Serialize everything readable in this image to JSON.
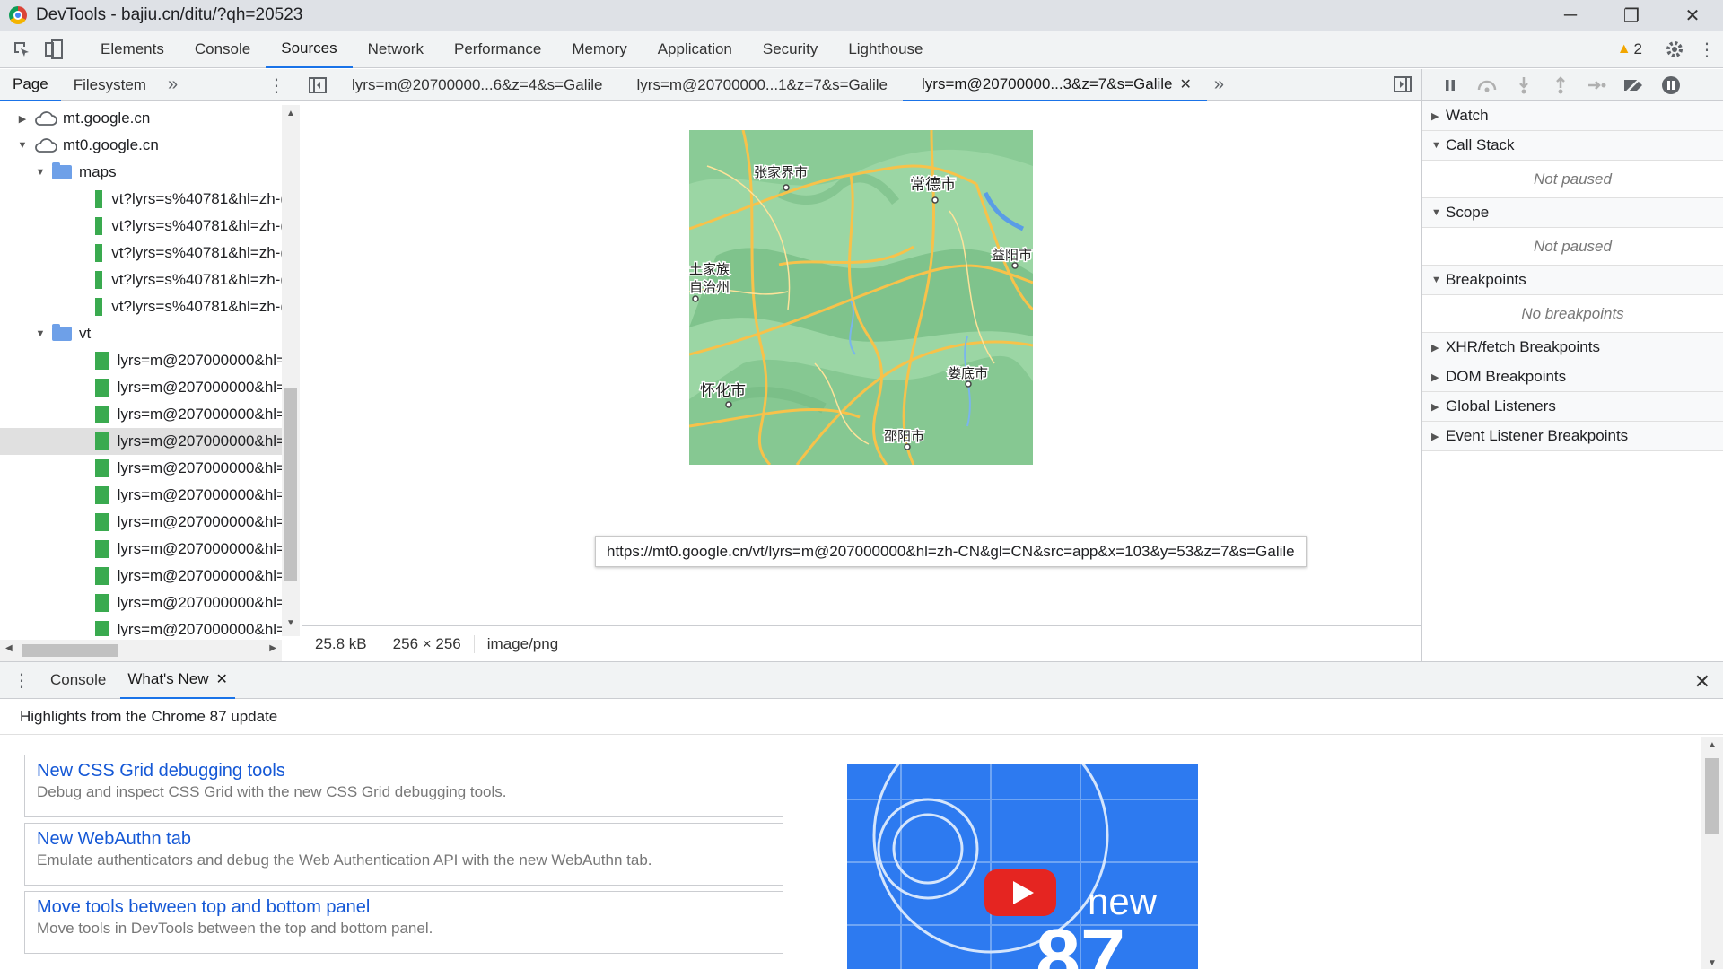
{
  "window": {
    "title": "DevTools - bajiu.cn/ditu/?qh=20523",
    "min": "─",
    "restore": "❐",
    "close": "✕"
  },
  "toolbar": {
    "tabs": [
      "Elements",
      "Console",
      "Sources",
      "Network",
      "Performance",
      "Memory",
      "Application",
      "Security",
      "Lighthouse"
    ],
    "active_tab": "Sources",
    "warning_count": "2"
  },
  "navigator": {
    "tabs": [
      "Page",
      "Filesystem"
    ],
    "more": "»",
    "tree": [
      {
        "label": "mt.google.cn",
        "type": "domain",
        "expanded": false,
        "indent": 0
      },
      {
        "label": "mt0.google.cn",
        "type": "domain",
        "expanded": true,
        "indent": 0
      },
      {
        "label": "maps",
        "type": "folder",
        "expanded": true,
        "indent": 1
      },
      {
        "label": "vt?lyrs=s%40781&hl=zh-(",
        "type": "file",
        "indent": 2
      },
      {
        "label": "vt?lyrs=s%40781&hl=zh-(",
        "type": "file",
        "indent": 2
      },
      {
        "label": "vt?lyrs=s%40781&hl=zh-(",
        "type": "file",
        "indent": 2
      },
      {
        "label": "vt?lyrs=s%40781&hl=zh-(",
        "type": "file",
        "indent": 2
      },
      {
        "label": "vt?lyrs=s%40781&hl=zh-(",
        "type": "file",
        "indent": 2
      },
      {
        "label": "vt",
        "type": "folder",
        "expanded": true,
        "indent": 1
      },
      {
        "label": "lyrs=m@207000000&hl=",
        "type": "file",
        "indent": 2
      },
      {
        "label": "lyrs=m@207000000&hl=",
        "type": "file",
        "indent": 2
      },
      {
        "label": "lyrs=m@207000000&hl=",
        "type": "file",
        "indent": 2
      },
      {
        "label": "lyrs=m@207000000&hl=",
        "type": "file",
        "indent": 2,
        "selected": true
      },
      {
        "label": "lyrs=m@207000000&hl=",
        "type": "file",
        "indent": 2
      },
      {
        "label": "lyrs=m@207000000&hl=",
        "type": "file",
        "indent": 2
      },
      {
        "label": "lyrs=m@207000000&hl=",
        "type": "file",
        "indent": 2
      },
      {
        "label": "lyrs=m@207000000&hl=",
        "type": "file",
        "indent": 2
      },
      {
        "label": "lyrs=m@207000000&hl=",
        "type": "file",
        "indent": 2
      },
      {
        "label": "lyrs=m@207000000&hl=",
        "type": "file",
        "indent": 2
      },
      {
        "label": "lyrs=m@207000000&hl=",
        "type": "file",
        "indent": 2
      }
    ]
  },
  "editor": {
    "tabs": [
      {
        "label": "lyrs=m@20700000...6&z=4&s=Galile",
        "active": false
      },
      {
        "label": "lyrs=m@20700000...1&z=7&s=Galile",
        "active": false
      },
      {
        "label": "lyrs=m@20700000...3&z=7&s=Galile",
        "active": true
      }
    ],
    "tooltip": "https://mt0.google.cn/vt/lyrs=m@207000000&hl=zh-CN&gl=CN&src=app&x=103&y=53&z=7&s=Galile",
    "map_labels": [
      "张家界市",
      "常德市",
      "益阳市",
      "土家族",
      "自治州",
      "怀化市",
      "娄底市",
      "邵阳市"
    ],
    "status": {
      "size": "25.8 kB",
      "dimensions": "256 × 256",
      "mime": "image/png"
    }
  },
  "debugger": {
    "sections": [
      {
        "title": "Watch",
        "expanded": false
      },
      {
        "title": "Call Stack",
        "expanded": true,
        "body": "Not paused"
      },
      {
        "title": "Scope",
        "expanded": true,
        "body": "Not paused"
      },
      {
        "title": "Breakpoints",
        "expanded": true,
        "body": "No breakpoints"
      },
      {
        "title": "XHR/fetch Breakpoints",
        "expanded": false
      },
      {
        "title": "DOM Breakpoints",
        "expanded": false
      },
      {
        "title": "Global Listeners",
        "expanded": false
      },
      {
        "title": "Event Listener Breakpoints",
        "expanded": false
      }
    ]
  },
  "drawer": {
    "tabs": [
      "Console",
      "What's New"
    ],
    "active_tab": "What's New",
    "header": "Highlights from the Chrome 87 update",
    "cards": [
      {
        "title": "New CSS Grid debugging tools",
        "desc": "Debug and inspect CSS Grid with the new CSS Grid debugging tools."
      },
      {
        "title": "New WebAuthn tab",
        "desc": "Emulate authenticators and debug the Web Authentication API with the new WebAuthn tab."
      },
      {
        "title": "Move tools between top and bottom panel",
        "desc": "Move tools in DevTools between the top and bottom panel."
      }
    ],
    "video_text": "new",
    "video_number": "87"
  },
  "colors": {
    "accent": "#1a73e8",
    "link": "#1558d6",
    "file_icon": "#3aaa4f",
    "folder_icon": "#6ea0e8",
    "video_bg": "#2d7af0",
    "warning": "#f2a600"
  }
}
